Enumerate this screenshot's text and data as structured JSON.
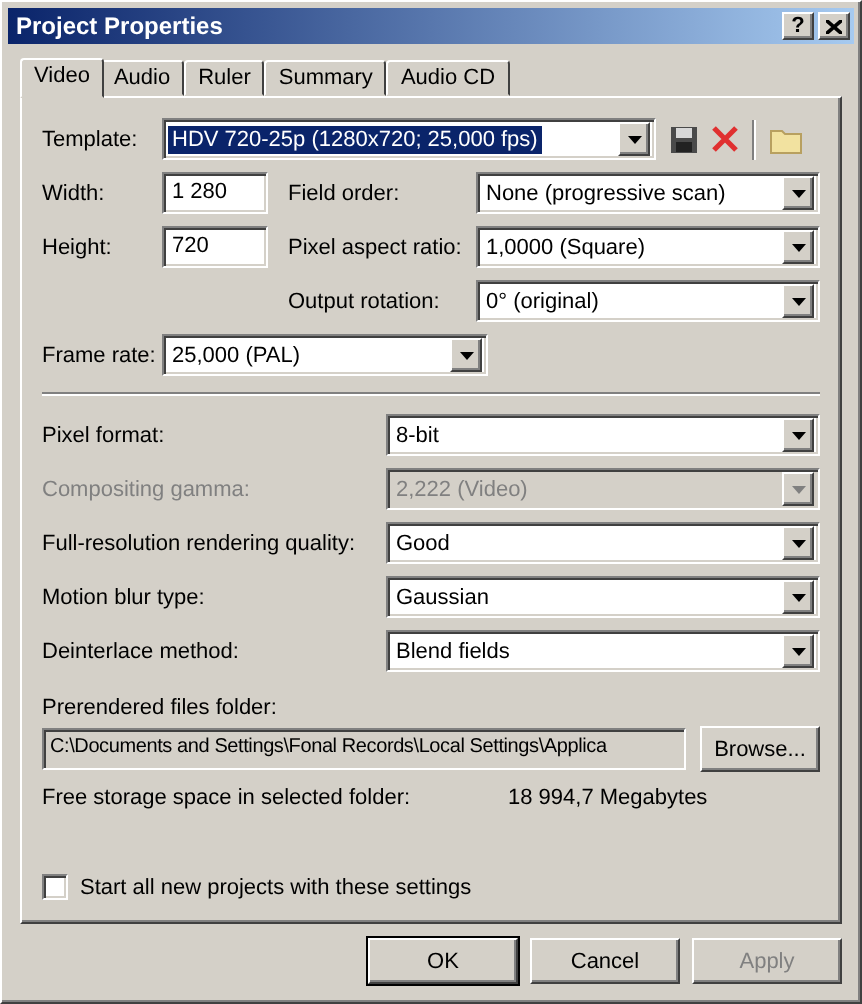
{
  "window": {
    "title": "Project Properties",
    "help_button": "?"
  },
  "tabs": [
    {
      "label": "Video",
      "selected": true
    },
    {
      "label": "Audio",
      "selected": false
    },
    {
      "label": "Ruler",
      "selected": false
    },
    {
      "label": "Summary",
      "selected": false
    },
    {
      "label": "Audio CD",
      "selected": false
    }
  ],
  "template": {
    "label": "Template:",
    "value": "HDV 720-25p (1280x720; 25,000 fps)",
    "text_selected": true
  },
  "width": {
    "label": "Width:",
    "value": "1 280"
  },
  "height": {
    "label": "Height:",
    "value": "720"
  },
  "field_order": {
    "label": "Field order:",
    "value": "None (progressive scan)"
  },
  "pixel_aspect_ratio": {
    "label": "Pixel aspect ratio:",
    "value": "1,0000 (Square)"
  },
  "output_rotation": {
    "label": "Output rotation:",
    "value": "0° (original)"
  },
  "frame_rate": {
    "label": "Frame rate:",
    "value": "25,000 (PAL)"
  },
  "settings": [
    {
      "label": "Pixel format:",
      "value": "8-bit",
      "disabled": false
    },
    {
      "label": "Compositing gamma:",
      "value": "2,222 (Video)",
      "disabled": true
    },
    {
      "label": "Full-resolution rendering quality:",
      "value": "Good",
      "disabled": false
    },
    {
      "label": "Motion blur type:",
      "value": "Gaussian",
      "disabled": false
    },
    {
      "label": "Deinterlace method:",
      "value": "Blend fields",
      "disabled": false
    }
  ],
  "prerendered_folder": {
    "label": "Prerendered files folder:",
    "path": "C:\\Documents and Settings\\Fonal Records\\Local Settings\\Applica",
    "browse_button": "Browse..."
  },
  "free_storage": {
    "label": "Free storage space in selected folder:",
    "value": "18 994,7 Megabytes"
  },
  "start_checkbox": {
    "label": "Start all new projects with these settings",
    "checked": false
  },
  "buttons": [
    {
      "label": "OK",
      "default": true,
      "disabled": false
    },
    {
      "label": "Cancel",
      "default": false,
      "disabled": false
    },
    {
      "label": "Apply",
      "default": false,
      "disabled": true
    }
  ]
}
